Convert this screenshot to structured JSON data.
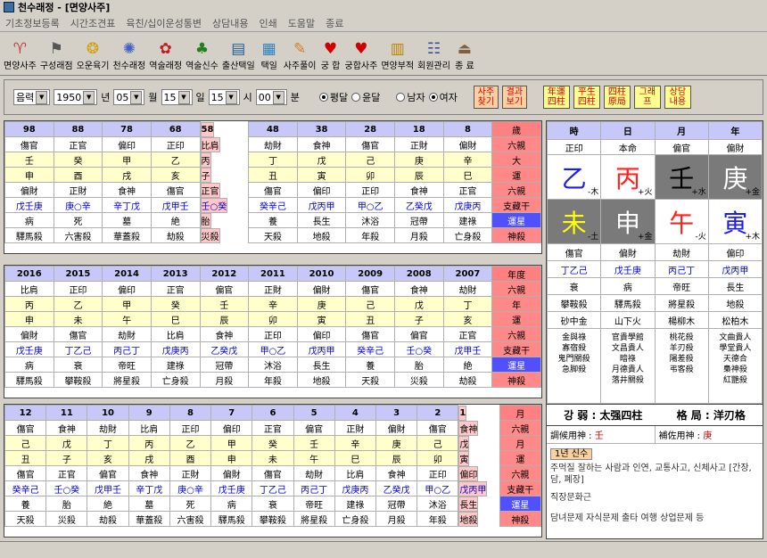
{
  "window": {
    "title": "천수래정 - [면양사주]"
  },
  "menu": [
    "기초정보등록",
    "시간조견표",
    "육친/십이운성통변",
    "상담내용",
    "인쇄",
    "도움말",
    "종료"
  ],
  "toolbar": [
    {
      "label": "면양사주",
      "icon": "person-chart-icon",
      "glyph": "♈"
    },
    {
      "label": "구성래점",
      "icon": "flag-icon",
      "glyph": "⚑"
    },
    {
      "label": "오운육기",
      "icon": "coin-icon",
      "glyph": "❂"
    },
    {
      "label": "천수래정",
      "icon": "wheel-icon",
      "glyph": "✺"
    },
    {
      "label": "역술래정",
      "icon": "flower-icon",
      "glyph": "✿"
    },
    {
      "label": "역술신수",
      "icon": "tree-icon",
      "glyph": "♣"
    },
    {
      "label": "출산택일",
      "icon": "card-icon",
      "glyph": "▤"
    },
    {
      "label": "택일",
      "icon": "calendar-icon",
      "glyph": "▦"
    },
    {
      "label": "사주풀이",
      "icon": "scroll-icon",
      "glyph": "✎"
    },
    {
      "label": "궁 합",
      "icon": "heart-icon",
      "glyph": "♥"
    },
    {
      "label": "궁합사주",
      "icon": "heart-icon",
      "glyph": "♥"
    },
    {
      "label": "면양부적",
      "icon": "talisman-icon",
      "glyph": "▥"
    },
    {
      "label": "회원관리",
      "icon": "members-icon",
      "glyph": "☷"
    },
    {
      "label": "종 료",
      "icon": "exit-icon",
      "glyph": "⏏"
    }
  ],
  "controls": {
    "calendar": "음력",
    "year": "1950",
    "year_unit": "년",
    "month": "05",
    "month_unit": "월",
    "day": "15",
    "day_unit": "일",
    "hour": "15",
    "hour_unit": "시",
    "minute": "00",
    "minute_unit": "분",
    "leap": [
      "평달",
      "윤달"
    ],
    "gender": [
      "남자",
      "여자"
    ],
    "buttons_orange": [
      "사주 찾기",
      "결과 보기"
    ],
    "buttons_yellow": [
      "年運 四柱",
      "平生 四柱",
      "四柱 原局",
      "그래 프",
      "상담 내용"
    ]
  },
  "panel1": {
    "nums": [
      "98",
      "88",
      "78",
      "68",
      "58",
      "48",
      "38",
      "28",
      "18",
      "8",
      "歲"
    ],
    "ten1": [
      "傷官",
      "正官",
      "偏印",
      "正印",
      "比肩",
      "劫財",
      "食神",
      "傷官",
      "正財",
      "偏財",
      "六親"
    ],
    "gan": [
      "壬",
      "癸",
      "甲",
      "乙",
      "丙",
      "丁",
      "戊",
      "己",
      "庚",
      "辛",
      "大"
    ],
    "zhi": [
      "申",
      "酉",
      "戌",
      "亥",
      "子",
      "丑",
      "寅",
      "卯",
      "辰",
      "巳",
      "運"
    ],
    "ten2": [
      "偏財",
      "正財",
      "食神",
      "傷官",
      "正官",
      "傷官",
      "偏印",
      "正印",
      "食神",
      "正官",
      "六親"
    ],
    "hidden": [
      "戊壬庚",
      "庚○辛",
      "辛丁戊",
      "戊甲壬",
      "壬○癸",
      "癸辛己",
      "戊丙甲",
      "甲○乙",
      "乙癸戊",
      "戊庚丙",
      "支藏干"
    ],
    "stage": [
      "病",
      "死",
      "墓",
      "絶",
      "胎",
      "養",
      "長生",
      "沐浴",
      "冠帶",
      "建祿",
      "運星"
    ],
    "sha": [
      "驛馬殺",
      "六害殺",
      "華蓋殺",
      "劫殺",
      "災殺",
      "天殺",
      "地殺",
      "年殺",
      "月殺",
      "亡身殺",
      "神殺"
    ]
  },
  "panel2": {
    "nums": [
      "2016",
      "2015",
      "2014",
      "2013",
      "2012",
      "2011",
      "2010",
      "2009",
      "2008",
      "2007",
      "年度"
    ],
    "ten1": [
      "比肩",
      "正印",
      "偏印",
      "正官",
      "偏官",
      "正財",
      "偏財",
      "傷官",
      "食神",
      "劫財",
      "六親"
    ],
    "gan": [
      "丙",
      "乙",
      "甲",
      "癸",
      "壬",
      "辛",
      "庚",
      "己",
      "戊",
      "丁",
      "年"
    ],
    "zhi": [
      "申",
      "未",
      "午",
      "巳",
      "辰",
      "卯",
      "寅",
      "丑",
      "子",
      "亥",
      "運"
    ],
    "ten2": [
      "偏財",
      "傷官",
      "劫財",
      "比肩",
      "食神",
      "正印",
      "偏印",
      "傷官",
      "偏官",
      "正官",
      "六親"
    ],
    "hidden": [
      "戊壬庚",
      "丁乙己",
      "丙己丁",
      "戊庚丙",
      "乙癸戊",
      "甲○乙",
      "戊丙甲",
      "癸辛己",
      "壬○癸",
      "戊甲壬",
      "支藏干"
    ],
    "stage": [
      "病",
      "衰",
      "帝旺",
      "建祿",
      "冠帶",
      "沐浴",
      "長生",
      "養",
      "胎",
      "絶",
      "運星"
    ],
    "sha": [
      "驛馬殺",
      "攀鞍殺",
      "將星殺",
      "亡身殺",
      "月殺",
      "年殺",
      "地殺",
      "天殺",
      "災殺",
      "劫殺",
      "神殺"
    ]
  },
  "panel3": {
    "nums": [
      "12",
      "11",
      "10",
      "9",
      "8",
      "7",
      "6",
      "5",
      "4",
      "3",
      "2",
      "1",
      "月"
    ],
    "ten1": [
      "傷官",
      "食神",
      "劫財",
      "比肩",
      "正印",
      "偏印",
      "正官",
      "偏官",
      "正財",
      "偏財",
      "傷官",
      "食神",
      "六親"
    ],
    "gan": [
      "己",
      "戊",
      "丁",
      "丙",
      "乙",
      "甲",
      "癸",
      "壬",
      "辛",
      "庚",
      "己",
      "戊",
      "月"
    ],
    "zhi": [
      "丑",
      "子",
      "亥",
      "戌",
      "酉",
      "申",
      "未",
      "午",
      "巳",
      "辰",
      "卯",
      "寅",
      "運"
    ],
    "ten2": [
      "傷官",
      "正官",
      "偏官",
      "食神",
      "正財",
      "偏財",
      "傷官",
      "劫財",
      "比肩",
      "食神",
      "正印",
      "偏印",
      "六親"
    ],
    "hidden": [
      "癸辛己",
      "壬○癸",
      "戊甲壬",
      "辛丁戊",
      "庚○辛",
      "戊壬庚",
      "丁乙己",
      "丙己丁",
      "戊庚丙",
      "乙癸戊",
      "甲○乙",
      "戊丙甲",
      "支藏干"
    ],
    "stage": [
      "養",
      "胎",
      "絶",
      "墓",
      "死",
      "病",
      "衰",
      "帝旺",
      "建祿",
      "冠帶",
      "沐浴",
      "長生",
      "運星"
    ],
    "sha": [
      "天殺",
      "災殺",
      "劫殺",
      "華蓋殺",
      "六害殺",
      "驛馬殺",
      "攀鞍殺",
      "將星殺",
      "亡身殺",
      "月殺",
      "年殺",
      "地殺",
      "神殺"
    ]
  },
  "right": {
    "heads": [
      "時",
      "日",
      "月",
      "年"
    ],
    "ten1": [
      "正印",
      "本命",
      "偏官",
      "偏財"
    ],
    "gan": [
      {
        "c": "乙",
        "el": "-木",
        "col": "#1a1aff"
      },
      {
        "c": "丙",
        "el": "+火",
        "col": "#ff2020"
      },
      {
        "c": "壬",
        "el": "+水",
        "col": "#000000"
      },
      {
        "c": "庚",
        "el": "+金",
        "col": "#ffffff"
      }
    ],
    "zhi": [
      {
        "c": "未",
        "el": "-土",
        "col": "#ffff00"
      },
      {
        "c": "申",
        "el": "+金",
        "col": "#ffffff"
      },
      {
        "c": "午",
        "el": "-火",
        "col": "#ff2020"
      },
      {
        "c": "寅",
        "el": "+木",
        "col": "#1a1aff"
      }
    ],
    "ten2": [
      "傷官",
      "偏財",
      "劫財",
      "偏印"
    ],
    "hidden": [
      "丁乙己",
      "戊壬庚",
      "丙己丁",
      "戊丙甲"
    ],
    "stage": [
      "衰",
      "病",
      "帝旺",
      "長生"
    ],
    "sha": [
      "攀鞍殺",
      "驛馬殺",
      "將星殺",
      "地殺"
    ],
    "nayin": [
      "砂中金",
      "山下火",
      "楊柳木",
      "松柏木"
    ],
    "sinsal": [
      "金與祿\n寡宿殺\n鬼門關殺\n急脚殺",
      "官貴學館\n文昌貴人\n暗祿\n月德貴人\n落井關殺",
      "桃花殺\n羊刃殺\n陽差殺\n弔客殺",
      "文曲貴人\n學堂貴人\n天德合\n梟神殺\n紅艷殺"
    ],
    "strength": "강 弱 : 太强四柱",
    "pattern": "格 局 : 洋刃格",
    "yongsin_label": "調候用神 : ",
    "yongsin": "壬",
    "husin_label": "補佐用神 : ",
    "husin": "庚",
    "tab": "1년 신수",
    "text1": "주먹질 잘하는 사람과 인연, 교통사고, 신체사고 [간장, 담, 폐장]",
    "text2": "직장문화근",
    "text3": "담녀문제 자식문제 출타 여행 상업문제 등"
  }
}
